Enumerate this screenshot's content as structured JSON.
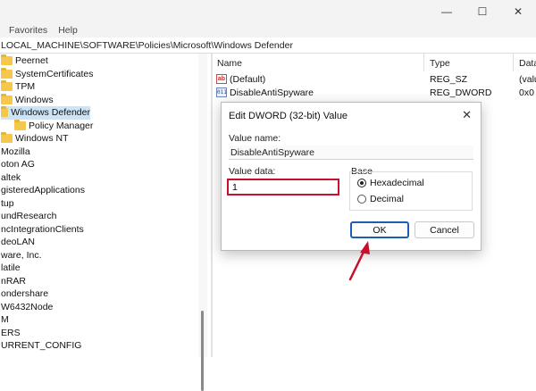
{
  "window": {
    "controls": {
      "minimize": "—",
      "maximize": "☐",
      "close": "✕"
    }
  },
  "menu": {
    "items": [
      "",
      "Favorites",
      "Help"
    ]
  },
  "address": "LOCAL_MACHINE\\SOFTWARE\\Policies\\Microsoft\\Windows Defender",
  "tree": {
    "items": [
      {
        "label": "Peernet",
        "folder": true
      },
      {
        "label": "SystemCertificates",
        "folder": true
      },
      {
        "label": "TPM",
        "folder": true
      },
      {
        "label": "Windows",
        "folder": true
      },
      {
        "label": "Windows Defender",
        "folder": true,
        "selected": true
      },
      {
        "label": "Policy Manager",
        "folder": true,
        "indent": 1
      },
      {
        "label": "Windows NT",
        "folder": true
      },
      {
        "label": "Mozilla",
        "folder": false
      },
      {
        "label": "oton AG",
        "folder": false
      },
      {
        "label": "altek",
        "folder": false
      },
      {
        "label": "gisteredApplications",
        "folder": false
      },
      {
        "label": "tup",
        "folder": false
      },
      {
        "label": "undResearch",
        "folder": false
      },
      {
        "label": "ncIntegrationClients",
        "folder": false
      },
      {
        "label": "deoLAN",
        "folder": false
      },
      {
        "label": "ware, Inc.",
        "folder": false
      },
      {
        "label": "latile",
        "folder": false
      },
      {
        "label": "nRAR",
        "folder": false
      },
      {
        "label": "ondershare",
        "folder": false
      },
      {
        "label": "W6432Node",
        "folder": false
      },
      {
        "label": "M",
        "folder": false
      },
      {
        "label": "ERS",
        "folder": false
      },
      {
        "label": "URRENT_CONFIG",
        "folder": false
      }
    ]
  },
  "values_pane": {
    "columns": [
      "Name",
      "Type",
      "Data"
    ],
    "rows": [
      {
        "name": "(Default)",
        "type": "REG_SZ",
        "data": "(valu",
        "icon": "ab"
      },
      {
        "name": "DisableAntiSpyware",
        "type": "REG_DWORD",
        "data": "0x0",
        "icon": "binary"
      }
    ]
  },
  "dialog": {
    "title": "Edit DWORD (32-bit) Value",
    "close": "✕",
    "value_name_label": "Value name:",
    "value_name": "DisableAntiSpyware",
    "value_data_label": "Value data:",
    "value_data": "1",
    "base_label": "Base",
    "base_options": [
      "Hexadecimal",
      "Decimal"
    ],
    "base_selected": "Hexadecimal",
    "ok_label": "OK",
    "cancel_label": "Cancel",
    "highlight_color": "#c8102e",
    "arrow_color": "#c8102e"
  }
}
